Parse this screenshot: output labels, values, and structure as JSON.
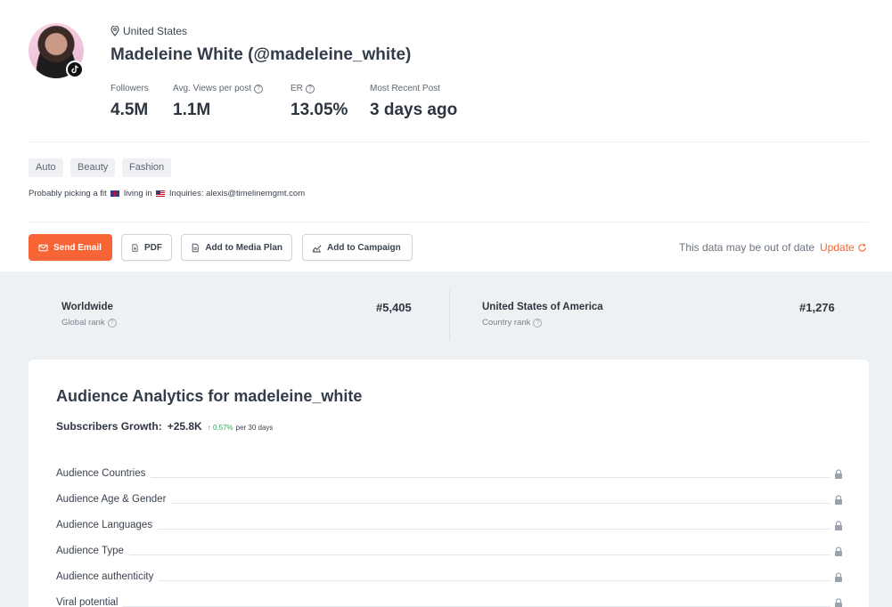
{
  "profile": {
    "location": "United States",
    "name": "Madeleine White (@madeleine_white)",
    "stats": [
      {
        "label": "Followers",
        "value": "4.5M",
        "help": false
      },
      {
        "label": "Avg. Views per post",
        "value": "1.1M",
        "help": true
      },
      {
        "label": "ER",
        "value": "13.05%",
        "help": true
      },
      {
        "label": "Most Recent Post",
        "value": "3 days ago",
        "help": false
      }
    ],
    "tags": [
      "Auto",
      "Beauty",
      "Fashion"
    ],
    "bio": {
      "part1": "Probably picking a fit",
      "part2": "living in",
      "part3": "Inquiries: alexis@timelinemgmt.com"
    }
  },
  "actions": {
    "send_email": "Send Email",
    "pdf": "PDF",
    "add_media_plan": "Add to Media Plan",
    "add_campaign": "Add to Campaign",
    "outdated_notice": "This data may be out of date",
    "update": "Update"
  },
  "ranks": {
    "global": {
      "title": "Worldwide",
      "subtitle": "Global rank",
      "value": "#5,405"
    },
    "country": {
      "title": "United States of America",
      "subtitle": "Country rank",
      "value": "#1,276"
    }
  },
  "analytics": {
    "title": "Audience Analytics for madeleine_white",
    "growth_label": "Subscribers Growth:",
    "growth_value": "+25.8K",
    "growth_pct": "↑ 0.57%",
    "growth_period": "per 30 days",
    "sections": [
      "Audience Countries",
      "Audience Age & Gender",
      "Audience Languages",
      "Audience Type",
      "Audience authenticity",
      "Viral potential"
    ]
  },
  "icons": {
    "platform_badge": "tiktok-icon",
    "location": "map-pin-icon",
    "help": "question-circle-icon",
    "lock": "lock-icon"
  },
  "colors": {
    "accent": "#f76536",
    "growth_up": "#2eaa5a",
    "background_gray": "#eef1f4"
  }
}
